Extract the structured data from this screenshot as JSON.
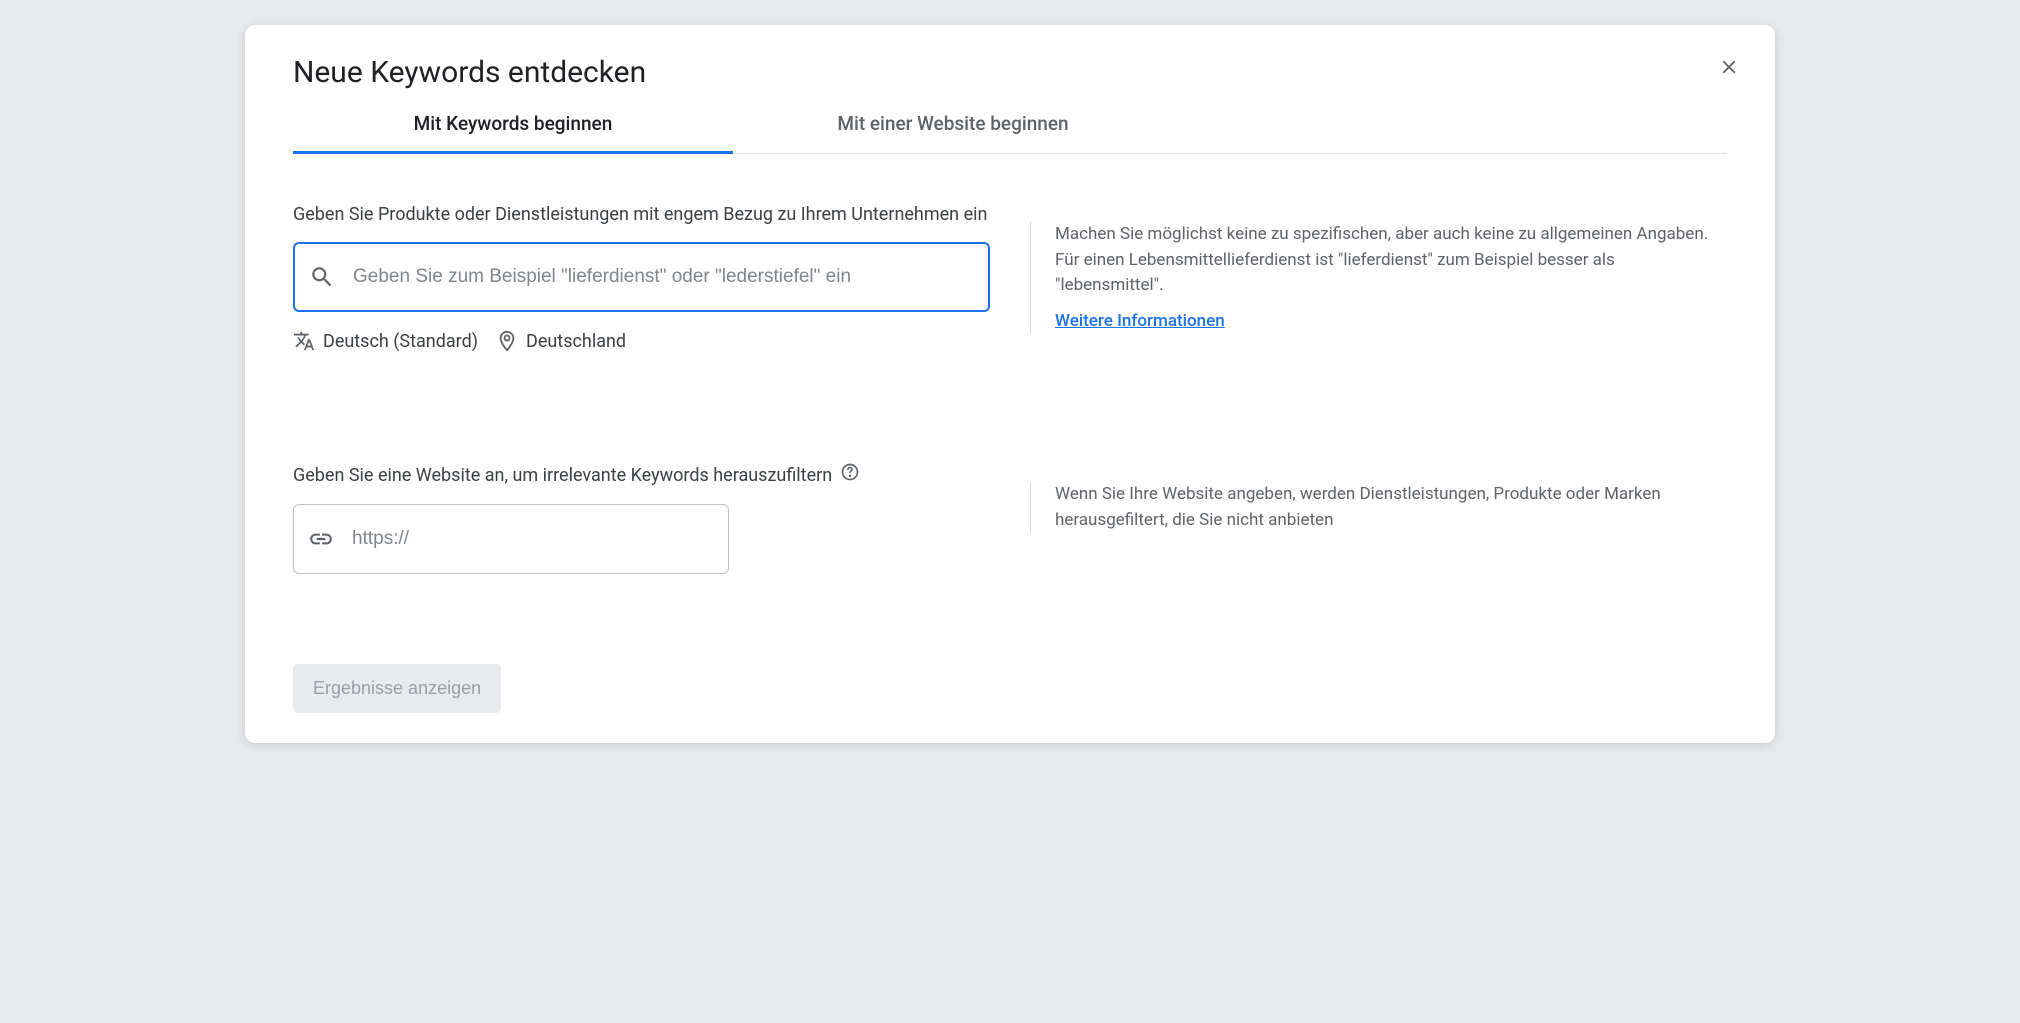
{
  "title": "Neue Keywords entdecken",
  "tabs": {
    "keywords": "Mit Keywords beginnen",
    "website": "Mit einer Website beginnen"
  },
  "section1": {
    "label": "Geben Sie Produkte oder Dienstleistungen mit engem Bezug zu Ihrem Unternehmen ein",
    "placeholder": "Geben Sie zum Beispiel \"lieferdienst\" oder \"lederstiefel\" ein",
    "language": "Deutsch (Standard)",
    "location": "Deutschland",
    "hint": "Machen Sie möglichst keine zu spezifischen, aber auch keine zu allgemeinen Angaben. Für einen Lebensmittellieferdienst ist \"lieferdienst\" zum Beispiel besser als \"lebensmittel\".",
    "hint_link": "Weitere Informationen"
  },
  "section2": {
    "label": "Geben Sie eine Website an, um irrelevante Keywords herauszufiltern",
    "placeholder": "https://",
    "hint": "Wenn Sie Ihre Website angeben, werden Dienstleistungen, Produkte oder Marken herausgefiltert, die Sie nicht anbieten"
  },
  "results_button": "Ergebnisse anzeigen"
}
